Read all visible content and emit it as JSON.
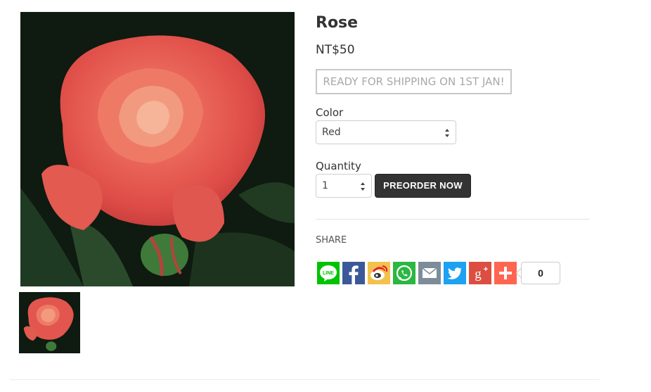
{
  "product": {
    "title": "Rose",
    "price": "NT$50",
    "shipping_badge": "READY FOR SHIPPING ON 1ST JAN!"
  },
  "options": {
    "color_label": "Color",
    "color_value": "Red",
    "quantity_label": "Quantity",
    "quantity_value": "1"
  },
  "actions": {
    "preorder_label": "PREORDER NOW"
  },
  "share": {
    "label": "SHARE",
    "count": "0",
    "buttons": [
      {
        "network": "line",
        "icon": "line-icon",
        "color": "#00c300"
      },
      {
        "network": "facebook",
        "icon": "facebook-icon",
        "color": "#3b5998"
      },
      {
        "network": "weibo",
        "icon": "weibo-icon",
        "color": "#f2c14e"
      },
      {
        "network": "whatsapp",
        "icon": "whatsapp-icon",
        "color": "#2bb741"
      },
      {
        "network": "email",
        "icon": "email-icon",
        "color": "#7d8c99"
      },
      {
        "network": "twitter",
        "icon": "twitter-icon",
        "color": "#1da1f2"
      },
      {
        "network": "googleplus",
        "icon": "google-plus-icon",
        "color": "#dc4e41"
      },
      {
        "network": "addthis",
        "icon": "plus-icon",
        "color": "#ff6550"
      }
    ]
  },
  "colors": {
    "button_dark": "#333333",
    "badge_border": "#c8c8c8"
  }
}
